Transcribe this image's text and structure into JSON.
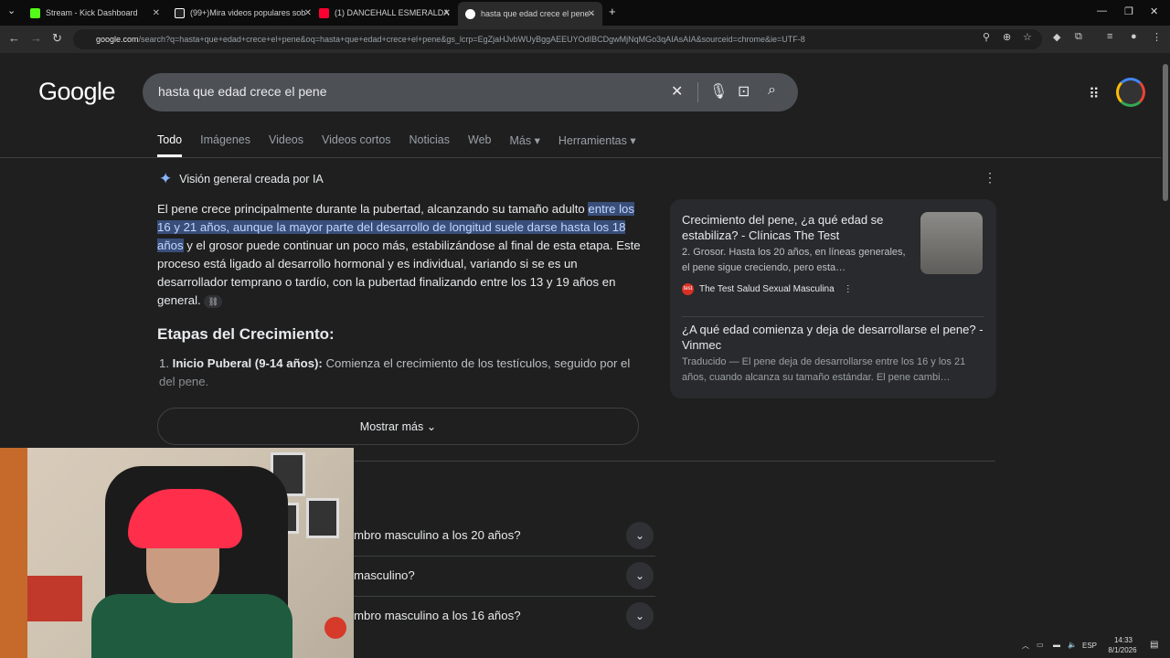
{
  "browser": {
    "tabs": [
      {
        "title": "Stream - Kick Dashboard",
        "color": "#53fc18"
      },
      {
        "title": "(99+)Mira videos populares sob",
        "color": "#ffffff"
      },
      {
        "title": "(1) DANCEHALL ESMERALDA",
        "color": "#ff0033"
      },
      {
        "title": "hasta que edad crece el pene -",
        "color": "#4285f4"
      }
    ],
    "url_host": "google.com",
    "url_rest": "/search?q=hasta+que+edad+crece+el+pene&oq=hasta+que+edad+crece+el+pene&gs_lcrp=EgZjaHJvbWUyBggAEEUYOdIBCDgwMjNqMGo3qAIAsAIA&sourceid=chrome&ie=UTF-8"
  },
  "google": {
    "logo": "Google",
    "query": "hasta que edad crece el pene",
    "nav_tabs": [
      "Todo",
      "Imágenes",
      "Videos",
      "Videos cortos",
      "Noticias",
      "Web",
      "Más ▾",
      "Herramientas ▾"
    ]
  },
  "ai_overview": {
    "heading": "Visión general creada por IA",
    "p1_a": "El pene crece principalmente durante la pubertad, alcanzando su tamaño adulto ",
    "p1_hl": "entre los 16 y 21 años, aunque la mayor parte del desarrollo de longitud suele darse hasta los 18 años",
    "p1_b": " y el grosor puede continuar un poco más, estabilizándose al final de esta etapa. Este proceso está ligado al desarrollo hormonal y es individual, variando si se es un desarrollador temprano o tardío, con la pubertad finalizando entre los 13 y 19 años en general.",
    "section_title": "Etapas del Crecimiento:",
    "item1_bold": "Inicio Puberal (9-14 años):",
    "item1_text": " Comienza el crecimiento de los testículos, seguido por el del pene.",
    "show_more": "Mostrar más"
  },
  "sources": [
    {
      "title": "Crecimiento del pene, ¿a qué edad se estabiliza? - Clínicas The Test",
      "snippet": "2. Grosor. Hasta los 20 años, en líneas generales, el pene sigue creciendo, pero esta…",
      "site": "The Test Salud Sexual Masculina"
    },
    {
      "title": "¿A qué edad comienza y deja de desarrollarse el pene? - Vinmec",
      "snippet": "Traducido — El pene deja de desarrollarse entre los 16 y los 21 años, cuando alcanza su tamaño estándar. El pene cambi…"
    }
  ],
  "faqs": [
    "mbro masculino a los 20 años?",
    "masculino?",
    "mbro masculino a los 16 años?"
  ],
  "system": {
    "lang": "ESP",
    "time": "14:33",
    "date": "8/1/2026"
  }
}
